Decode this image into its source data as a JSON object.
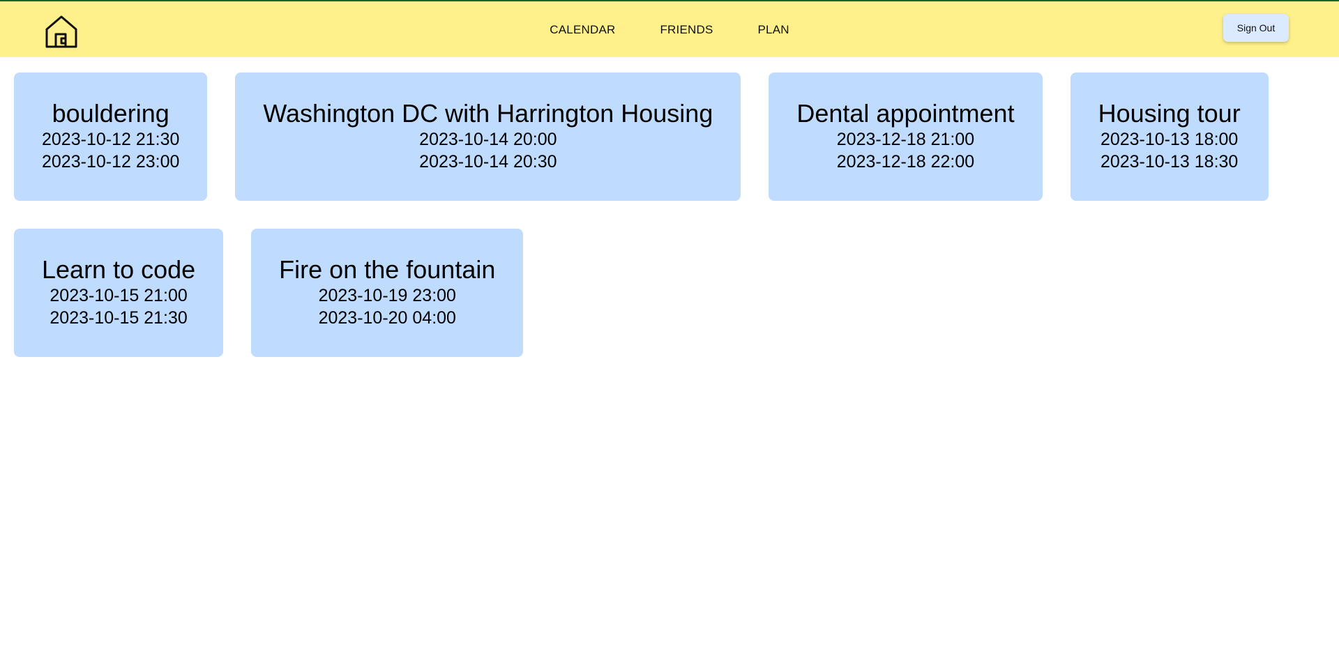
{
  "header": {
    "home_icon": "house-icon",
    "background_color": "#fef08a",
    "nav": [
      {
        "label": "CALENDAR"
      },
      {
        "label": "FRIENDS"
      },
      {
        "label": "PLAN"
      }
    ],
    "sign_out_label": "Sign Out"
  },
  "events": [
    {
      "title": "bouldering",
      "start": "2023-10-12 21:30",
      "end": "2023-10-12 23:00"
    },
    {
      "title": "Washington DC with Harrington Housing",
      "start": "2023-10-14 20:00",
      "end": "2023-10-14 20:30"
    },
    {
      "title": "Dental appointment",
      "start": "2023-12-18 21:00",
      "end": "2023-12-18 22:00"
    },
    {
      "title": "Housing tour",
      "start": "2023-10-13 18:00",
      "end": "2023-10-13 18:30"
    },
    {
      "title": "Learn to code",
      "start": "2023-10-15 21:00",
      "end": "2023-10-15 21:30"
    },
    {
      "title": "Fire on the fountain",
      "start": "2023-10-19 23:00",
      "end": "2023-10-20 04:00"
    }
  ],
  "colors": {
    "card_background": "#bfdbfe",
    "button_background": "#dbeafe"
  }
}
